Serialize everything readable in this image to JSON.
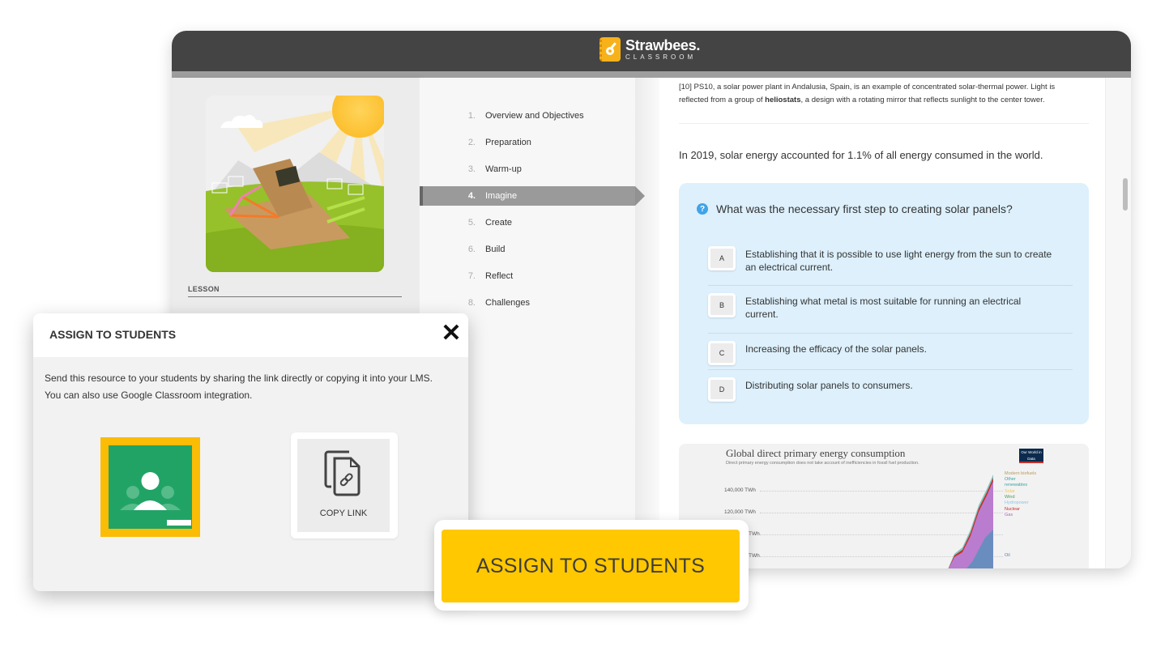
{
  "app": {
    "brand": "Strawbees.",
    "brand_sub": "CLASSROOM",
    "brand_color": "#f7b21b"
  },
  "lesson": {
    "label": "LESSON",
    "image_alt": "Solar tracker made of cardboard and straws under a sun"
  },
  "toc": {
    "items": [
      {
        "num": "1.",
        "label": "Overview and Objectives"
      },
      {
        "num": "2.",
        "label": "Preparation"
      },
      {
        "num": "3.",
        "label": "Warm-up"
      },
      {
        "num": "4.",
        "label": "Imagine",
        "active": true
      },
      {
        "num": "5.",
        "label": "Create"
      },
      {
        "num": "6.",
        "label": "Build"
      },
      {
        "num": "7.",
        "label": "Reflect"
      },
      {
        "num": "8.",
        "label": "Challenges"
      }
    ]
  },
  "content": {
    "footnote_prefix": "[10] PS10, a solar power plant in Andalusia, Spain, is an example of concentrated solar-thermal power. Light is reflected from a group of ",
    "footnote_bold": "heliostats",
    "footnote_suffix": ", a design with a rotating mirror that reflects sunlight to the center tower.",
    "stat": "In 2019, solar energy accounted for 1.1% of all energy consumed in the world.",
    "quiz": {
      "question": "What was the necessary first step to creating solar panels?",
      "icon": "question-circle-icon",
      "options": [
        {
          "key": "A",
          "text": "Establishing that it is possible to use light energy from the sun to create an electrical current."
        },
        {
          "key": "B",
          "text": "Establishing what metal is most suitable for running an electrical current."
        },
        {
          "key": "C",
          "text": "Increasing the efficacy of the solar panels."
        },
        {
          "key": "D",
          "text": "Distributing solar panels to consumers."
        }
      ]
    },
    "chart": {
      "title": "Global direct primary energy consumption",
      "subtitle": "Direct primary energy consumption does not take account of inefficiencies in fossil fuel production.",
      "badge": "Our World in Data",
      "y_ticks": [
        "140,000 TWh",
        "120,000 TWh",
        "TWh",
        "TWh"
      ],
      "legend": [
        {
          "label": "Modern biofuels",
          "color": "#b79a5c"
        },
        {
          "label": "Other",
          "color": "#3aa3a3"
        },
        {
          "label": "renewables",
          "color": "#3aa3a3"
        },
        {
          "label": "Solar",
          "color": "#f2c94c"
        },
        {
          "label": "Wind",
          "color": "#4e9a5a"
        },
        {
          "label": "Hydropower",
          "color": "#8cc6e8"
        },
        {
          "label": "Nuclear",
          "color": "#c5312b"
        },
        {
          "label": "Gas",
          "color": "#b15fbf"
        },
        {
          "label": "Oil",
          "color": "#5a7fae"
        }
      ]
    }
  },
  "modal": {
    "title": "ASSIGN TO STUDENTS",
    "body_line1": "Send this resource to your students by sharing the link directly or copying it into your LMS.",
    "body_line2": "You can also use Google Classroom integration.",
    "google_classroom_label": "Google Classroom",
    "copy_link_label": "COPY LINK"
  },
  "cta": {
    "label": "ASSIGN TO STUDENTS",
    "color": "#ffc800"
  }
}
